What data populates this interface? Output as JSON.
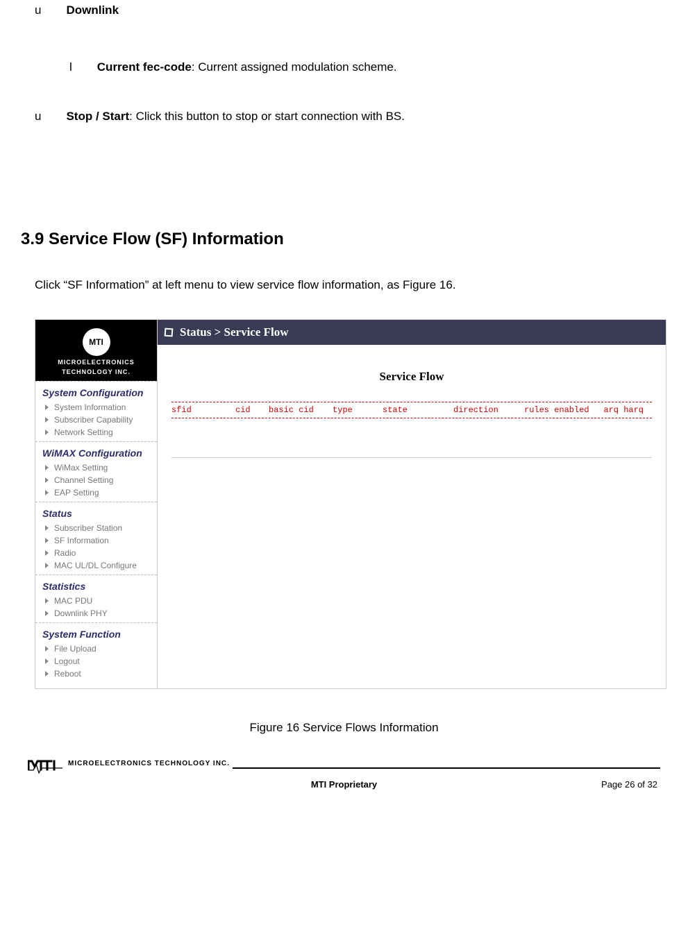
{
  "top_list": {
    "item1": {
      "bullet": "u",
      "bold": "Downlink"
    },
    "item2": {
      "bullet": "l",
      "bold": "Current fec-code",
      "rest": ": Current assigned modulation scheme."
    },
    "item3": {
      "bullet": "u",
      "bold": "Stop / Start",
      "rest": ": Click this button to stop or start connection with BS."
    }
  },
  "section_heading": "3.9    Service Flow (SF) Information",
  "section_para": "Click “SF Information” at left menu to view service flow information, as Figure 16.",
  "shot": {
    "logo_badge": "MTI",
    "logo_sub1": "MICROELECTRONICS",
    "logo_sub2": "TECHNOLOGY INC.",
    "nav": {
      "sys_conf": {
        "heading": "System Configuration",
        "items": [
          "System Information",
          "Subscriber Capability",
          "Network Setting"
        ]
      },
      "wimax": {
        "heading": "WiMAX Configuration",
        "items": [
          "WiMax Setting",
          "Channel Setting",
          "EAP Setting"
        ]
      },
      "status": {
        "heading": "Status",
        "items": [
          "Subscriber Station",
          "SF Information",
          "Radio",
          "MAC UL/DL Configure"
        ]
      },
      "stats": {
        "heading": "Statistics",
        "items": [
          "MAC PDU",
          "Downlink PHY"
        ]
      },
      "sysfn": {
        "heading": "System Function",
        "items": [
          "File Upload",
          "Logout",
          "Reboot"
        ]
      }
    },
    "breadcrumb": "Status > Service Flow",
    "panel_title": "Service Flow",
    "cols": {
      "sfid": "sfid",
      "cid": "cid",
      "bcid": "basic cid",
      "type": "type",
      "state": "state",
      "dir": "direction",
      "rules": "rules enabled",
      "arq": "arq harq"
    }
  },
  "caption": "Figure 16    Service Flows Information",
  "footer": {
    "logo_text": "MICROELECTRONICS TECHNOLOGY INC.",
    "center": "MTI Proprietary",
    "right": "Page 26 of 32"
  }
}
